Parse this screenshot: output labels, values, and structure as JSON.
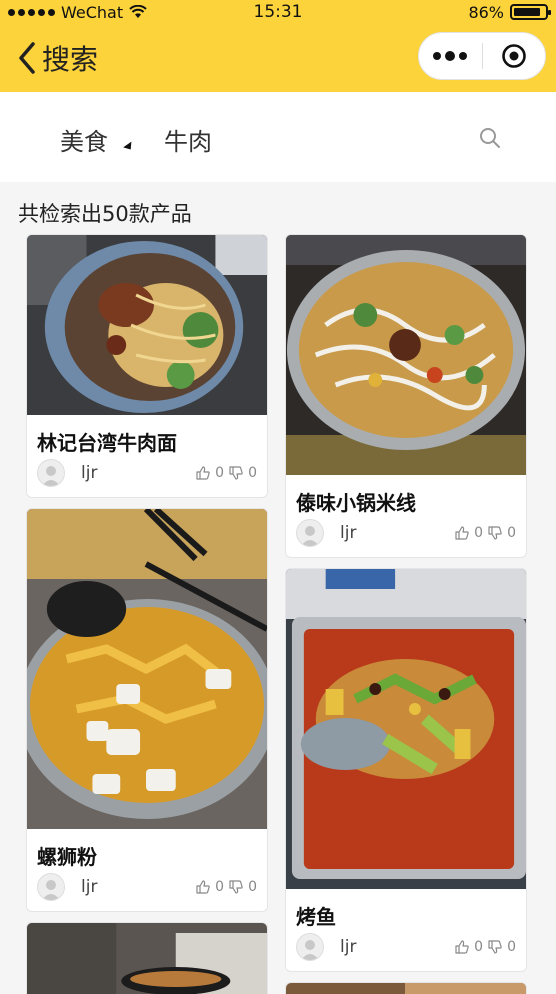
{
  "status_bar": {
    "carrier": "WeChat",
    "time": "15:31",
    "battery": "86%",
    "battery_level": 0.86
  },
  "nav": {
    "title": "搜索"
  },
  "filter": {
    "category": "美食",
    "keyword": "牛肉"
  },
  "results": {
    "count_text": "共检索出50款产品"
  },
  "cards": [
    {
      "title": "林记台湾牛肉面",
      "author": "ljr",
      "likes": "0",
      "dislikes": "0"
    },
    {
      "title": "傣味小锅米线",
      "author": "ljr",
      "likes": "0",
      "dislikes": "0"
    },
    {
      "title": "螺狮粉",
      "author": "ljr",
      "likes": "0",
      "dislikes": "0"
    },
    {
      "title": "烤鱼",
      "author": "ljr",
      "likes": "0",
      "dislikes": "0"
    }
  ],
  "icons": {
    "back": "chevron-left-icon",
    "more": "more-dots-icon",
    "close": "target-icon",
    "search": "search-icon",
    "like": "thumbs-up-icon",
    "dislike": "thumbs-down-icon"
  },
  "colors": {
    "brand_yellow": "#fcd33a",
    "page_bg": "#f5f5f5"
  }
}
